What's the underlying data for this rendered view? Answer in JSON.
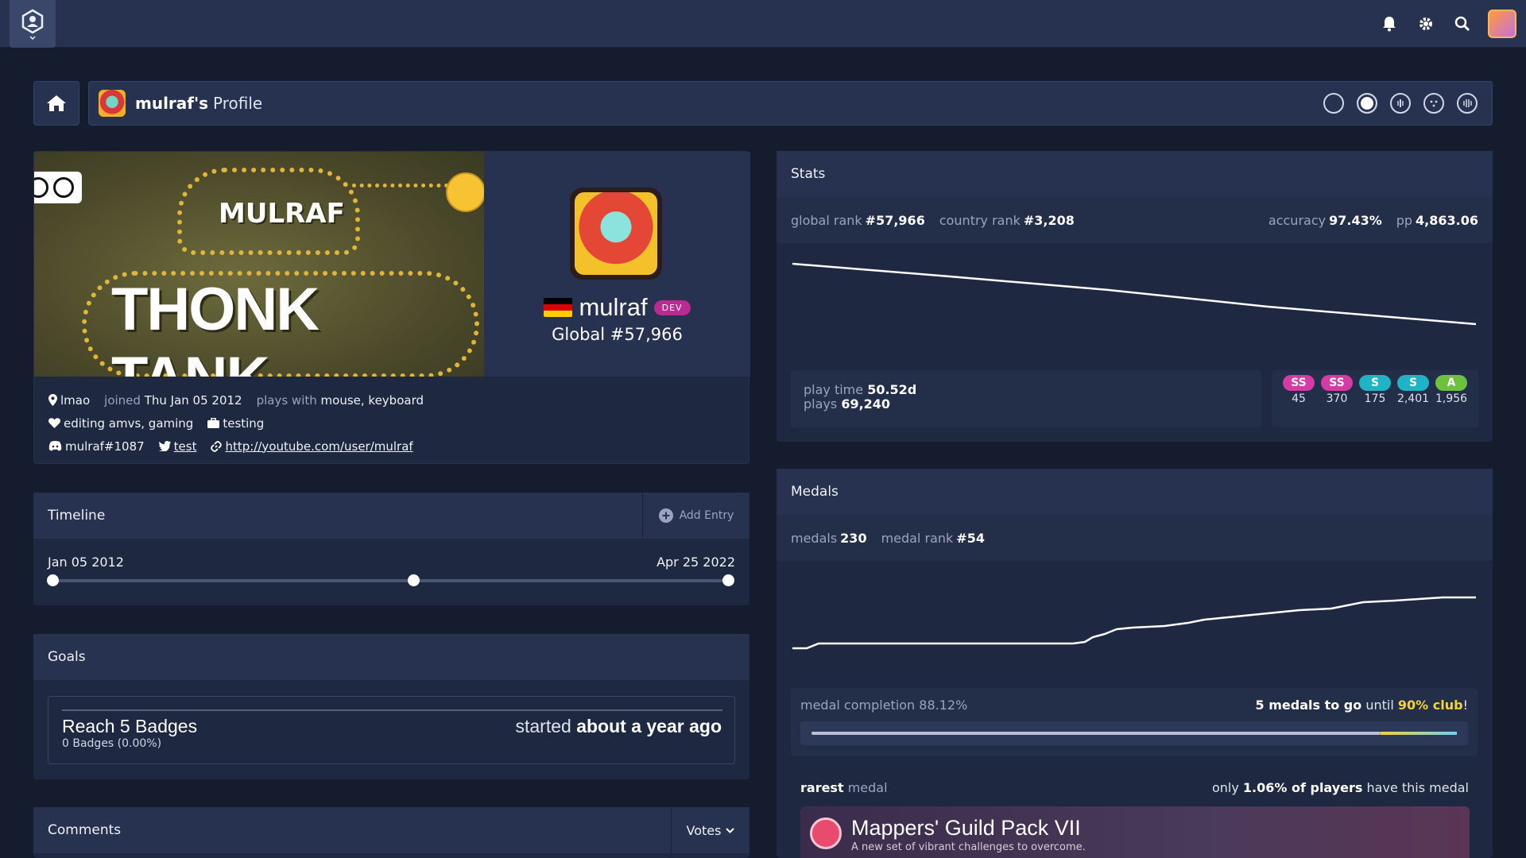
{
  "profile_title": {
    "name": "mulraf's",
    "suffix": "Profile"
  },
  "banner": {
    "small_text": "MULRAF",
    "big_text": "THONK TANK"
  },
  "user": {
    "username": "mulraf",
    "badge": "DEV",
    "global_rank": "Global #57,966",
    "location": "lmao",
    "joined_label": "joined",
    "joined_date": "Thu Jan 05 2012",
    "plays_with_label": "plays with",
    "plays_with": "mouse, keyboard",
    "interests": "editing amvs, gaming",
    "occupation": "testing",
    "discord": "mulraf#1087",
    "twitter": "test",
    "website": "http://youtube.com/user/mulraf",
    "flag_country": "Germany"
  },
  "timeline": {
    "title": "Timeline",
    "add_entry": "Add Entry",
    "start_date": "Jan 05 2012",
    "end_date": "Apr 25 2022"
  },
  "goals": {
    "title": "Goals",
    "item": {
      "title": "Reach 5 Badges",
      "progress": "0 Badges (0.00%)",
      "started_label": "started",
      "started_when": "about a year ago"
    }
  },
  "comments": {
    "title": "Comments",
    "sort": "Votes"
  },
  "stats": {
    "title": "Stats",
    "global_rank_label": "global rank",
    "global_rank": "#57,966",
    "country_rank_label": "country rank",
    "country_rank": "#3,208",
    "accuracy_label": "accuracy",
    "accuracy": "97.43%",
    "pp_label": "pp",
    "pp": "4,863.06",
    "play_time_label": "play time",
    "play_time": "50.52d",
    "plays_label": "plays",
    "plays": "69,240",
    "grades": [
      {
        "label": "SS",
        "count": "45",
        "color": "#d63aa6"
      },
      {
        "label": "SS",
        "count": "370",
        "color": "#d63aa6"
      },
      {
        "label": "S",
        "count": "175",
        "color": "#1fb3c5"
      },
      {
        "label": "S",
        "count": "2,401",
        "color": "#1fb3c5"
      },
      {
        "label": "A",
        "count": "1,956",
        "color": "#6cc13f"
      }
    ]
  },
  "medals": {
    "title": "Medals",
    "medals_label": "medals",
    "medals": "230",
    "medal_rank_label": "medal rank",
    "medal_rank": "#54",
    "completion_label": "medal completion",
    "completion": "88.12%",
    "completion_fraction": 0.8812,
    "to_go": "5 medals to go",
    "until": "until",
    "club": "90% club",
    "bang": "!",
    "rarest_label": "rarest",
    "medal_word": "medal",
    "only": "only",
    "rarity": "1.06% of players",
    "have": "have this medal",
    "rarest_name": "Mappers' Guild Pack VII",
    "rarest_desc": "A new set of vibrant challenges to overcome."
  }
}
